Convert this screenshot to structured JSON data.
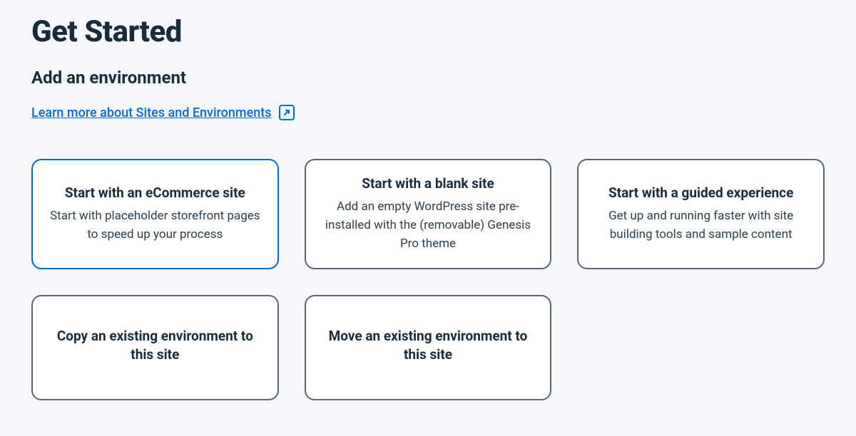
{
  "header": {
    "title": "Get Started",
    "subtitle": "Add an environment",
    "learn_link": "Learn more about Sites and Environments"
  },
  "cards": [
    {
      "title": "Start with an eCommerce site",
      "desc": "Start with placeholder storefront pages to speed up your process",
      "selected": true
    },
    {
      "title": "Start with a blank site",
      "desc": "Add an empty WordPress site pre-installed with the (removable) Genesis Pro theme",
      "selected": false
    },
    {
      "title": "Start with a guided experience",
      "desc": "Get up and running faster with site building tools and sample content",
      "selected": false
    },
    {
      "title": "Copy an existing environment to this site",
      "desc": "",
      "selected": false
    },
    {
      "title": "Move an existing environment to this site",
      "desc": "",
      "selected": false
    }
  ]
}
